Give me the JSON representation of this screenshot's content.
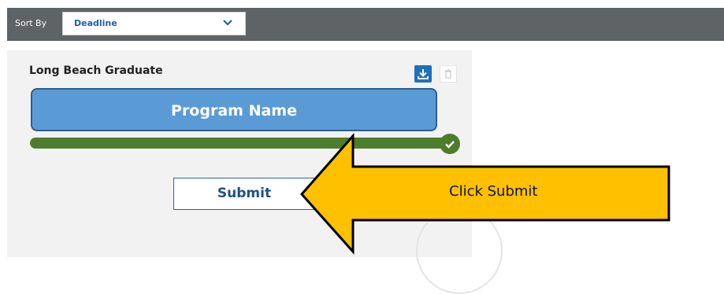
{
  "sort": {
    "label": "Sort By",
    "selected": "Deadline"
  },
  "card": {
    "title": "Long Beach Graduate",
    "progress_percent": 100,
    "submit_label": "Submit"
  },
  "annotations": {
    "program_name_label": "Program Name",
    "arrow_label": "Click Submit"
  },
  "colors": {
    "toolbar_bg": "#5f6366",
    "accent_blue": "#1f6fbf",
    "progress_green": "#4c7d2c",
    "callout_blue": "#5b9bd5",
    "arrow_gold": "#ffc000"
  },
  "icons": {
    "sort_chevron": "chevron-down-icon",
    "download": "download-icon",
    "delete": "trash-icon",
    "complete": "checkmark-icon",
    "watermark": "seal-icon"
  }
}
